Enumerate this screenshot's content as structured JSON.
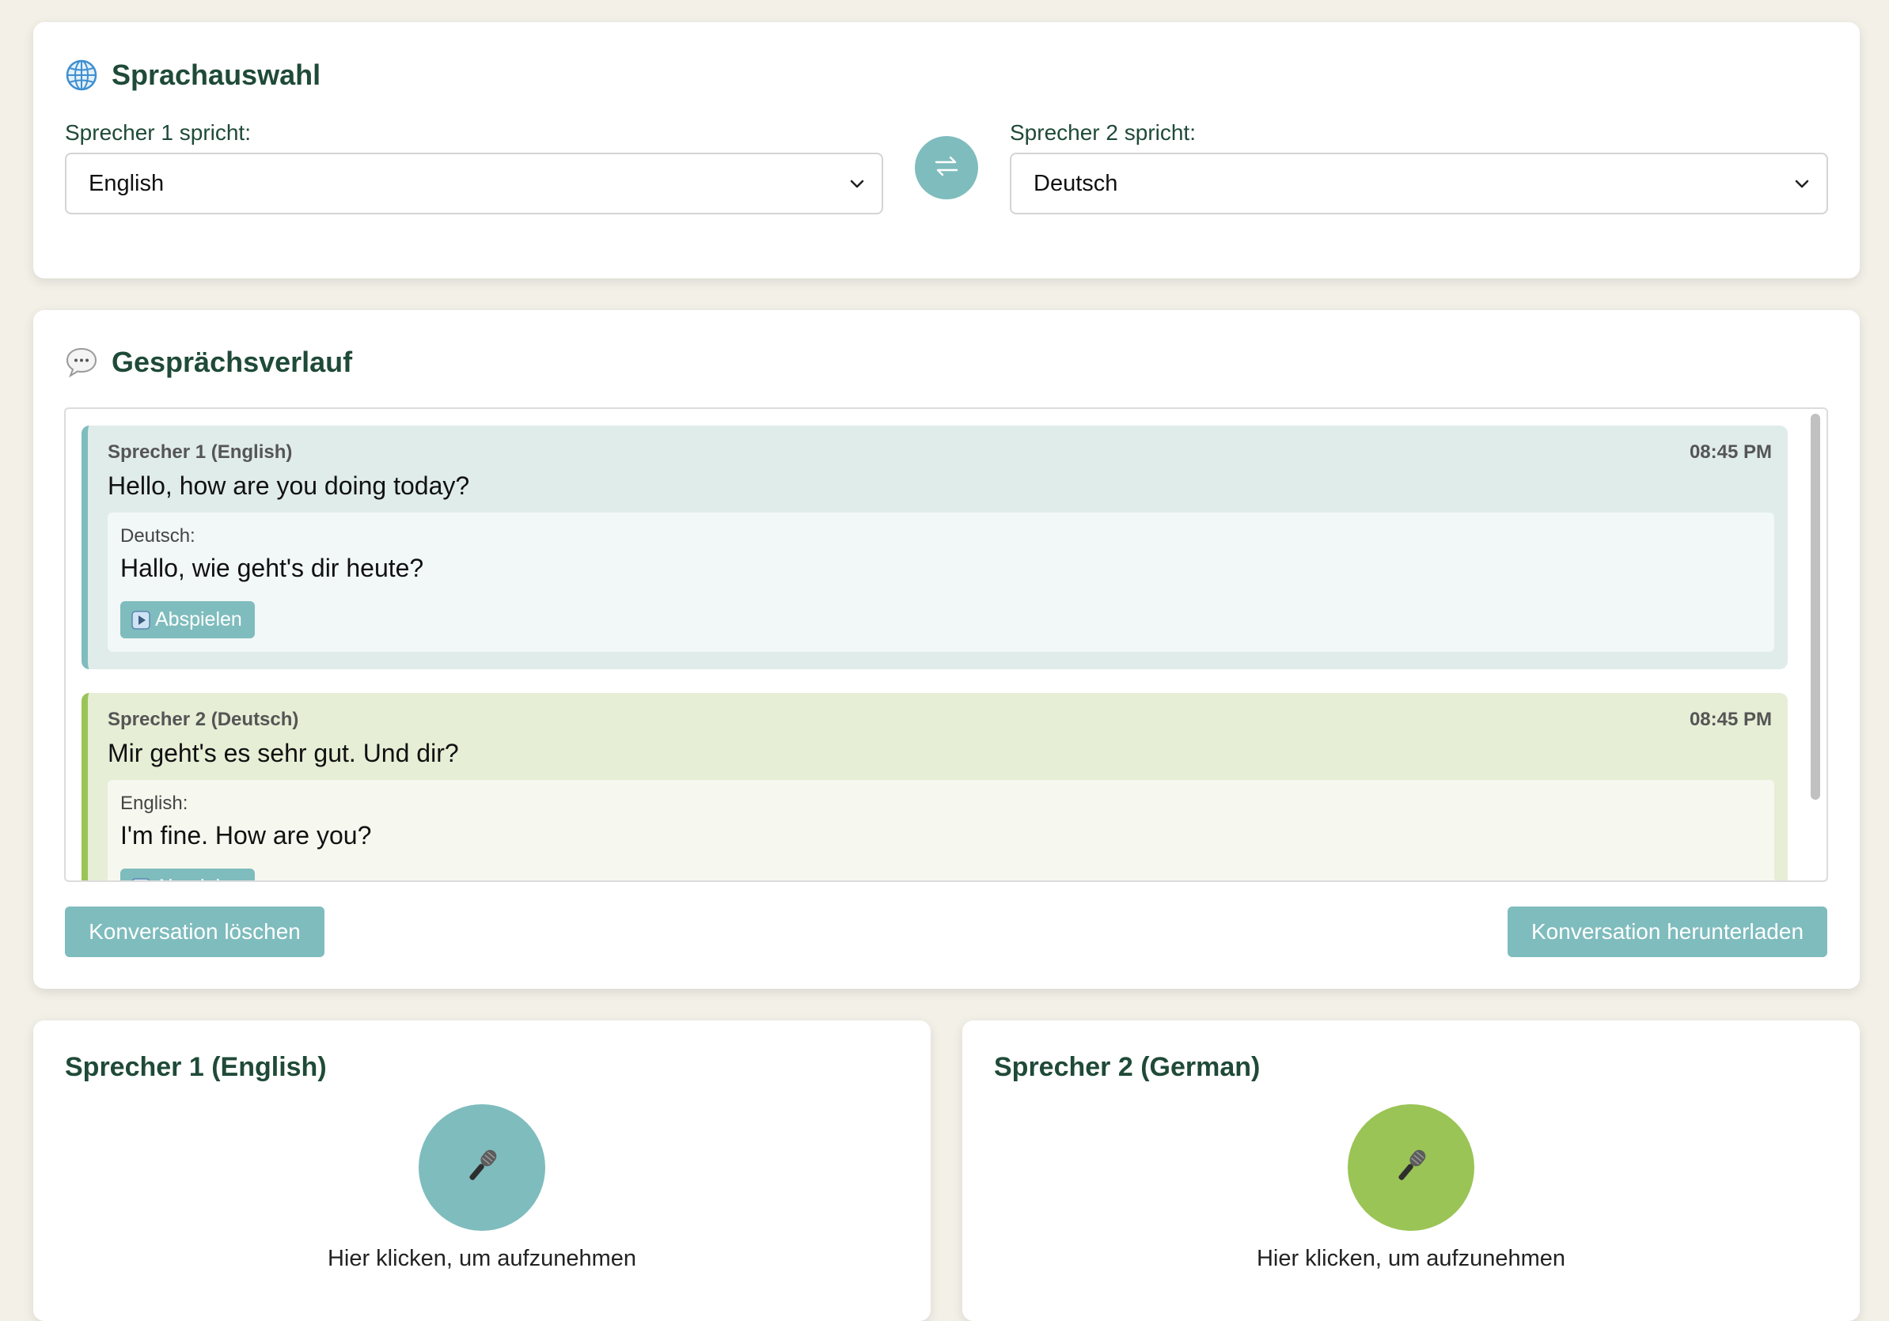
{
  "language_section": {
    "title": "Sprachauswahl",
    "icon": "globe-icon",
    "speaker1_label": "Sprecher 1 spricht:",
    "speaker1_value": "English",
    "speaker2_label": "Sprecher 2 spricht:",
    "speaker2_value": "Deutsch",
    "swap_icon": "swap-arrows-icon"
  },
  "history_section": {
    "title": "Gesprächsverlauf",
    "icon": "speech-bubble-icon",
    "messages": [
      {
        "speaker": "Sprecher 1 (English)",
        "time": "08:45 PM",
        "original": "Hello, how are you doing today?",
        "translation_language": "Deutsch:",
        "translation": "Hallo, wie geht's dir heute?",
        "play_label": "Abspielen"
      },
      {
        "speaker": "Sprecher 2 (Deutsch)",
        "time": "08:45 PM",
        "original": "Mir geht's es sehr gut. Und dir?",
        "translation_language": "English:",
        "translation": "I'm fine. How are you?",
        "play_label": "Abspielen"
      }
    ],
    "clear_label": "Konversation löschen",
    "download_label": "Konversation herunterladen"
  },
  "speaker_panels": [
    {
      "title": "Sprecher 1 (English)",
      "hint": "Hier klicken, um aufzunehmen",
      "color": "#7fbcbd",
      "icon": "microphone-icon"
    },
    {
      "title": "Sprecher 2 (German)",
      "hint": "Hier klicken, um aufzunehmen",
      "color": "#9ac456",
      "icon": "microphone-icon"
    }
  ],
  "colors": {
    "accent": "#7fbcbd",
    "accent_green": "#9ac456",
    "heading": "#1f4a38",
    "background": "#f2f0e7"
  }
}
